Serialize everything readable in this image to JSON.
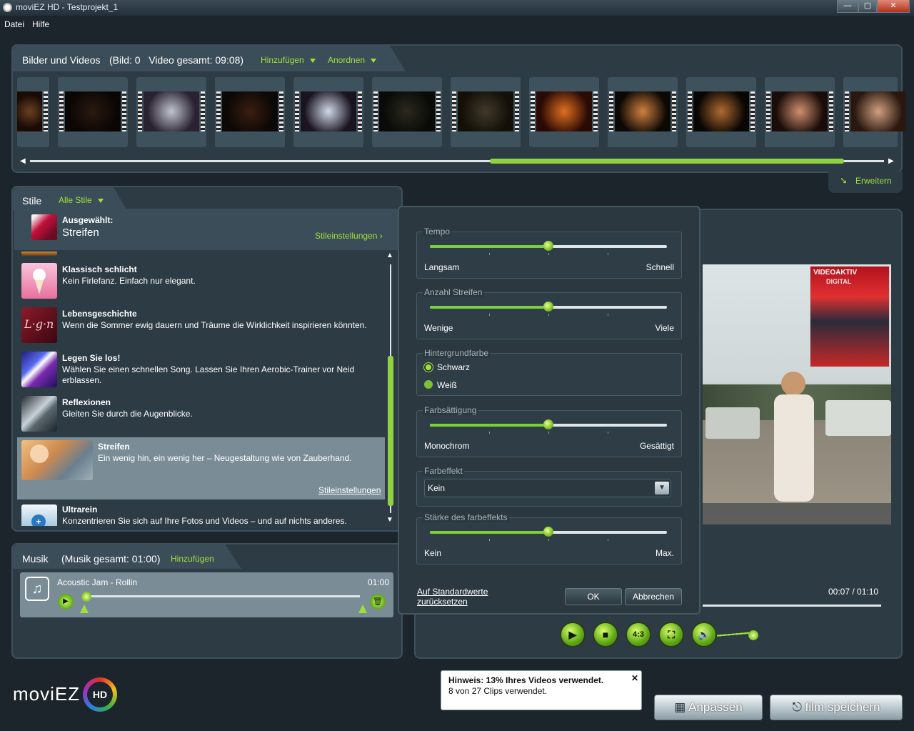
{
  "window": {
    "title": "moviEZ HD - Testprojekt_1",
    "min": "—",
    "max": "▢",
    "close": "✕"
  },
  "menu": [
    "Datei",
    "Hilfe"
  ],
  "media": {
    "title": "Bilder und Videos",
    "info": "(Bild: 0   Video gesamt: 09:08)",
    "add": "Hinzufügen",
    "arrange": "Anordnen",
    "expand": "Erweitern",
    "scroll_fraction": 0.44
  },
  "styles": {
    "title": "Stile",
    "filter": "Alle Stile",
    "selected_label": "Ausgewählt:",
    "selected_name": "Streifen",
    "settings_link": "Stileinstellungen",
    "items": [
      {
        "name": "Klassisch schlicht",
        "desc": "Kein Firlefanz. Einfach nur elegant."
      },
      {
        "name": "Lebensgeschichte",
        "desc": "Wenn die Sommer ewig dauern und Träume die Wirklichkeit inspirieren könnten."
      },
      {
        "name": "Legen Sie los!",
        "desc": "Wählen Sie einen schnellen Song. Lassen Sie Ihren Aerobic-Trainer vor Neid erblassen."
      },
      {
        "name": "Reflexionen",
        "desc": "Gleiten Sie durch die Augenblicke."
      },
      {
        "name": "Streifen",
        "desc": "Ein wenig hin, ein wenig her – Neugestaltung wie von Zauberhand.",
        "link": "Stileinstellungen"
      },
      {
        "name": "Ultrarein",
        "desc": "Konzentrieren Sie sich auf Ihre Fotos und Videos – und auf nichts anderes."
      }
    ]
  },
  "music": {
    "title": "Musik",
    "info": "(Musik gesamt: 01:00)",
    "add": "Hinzufügen",
    "track": "Acoustic Jam - Rollin",
    "duration": "01:00"
  },
  "dialog": {
    "tempo": {
      "label": "Tempo",
      "lo": "Langsam",
      "hi": "Schnell",
      "value": 0.5
    },
    "stripes": {
      "label": "Anzahl Streifen",
      "lo": "Wenige",
      "hi": "Viele",
      "value": 0.5
    },
    "bg": {
      "label": "Hintergrundfarbe",
      "opt1": "Schwarz",
      "opt2": "Weiß",
      "selected": "Schwarz"
    },
    "saturation": {
      "label": "Farbsättigung",
      "lo": "Monochrom",
      "hi": "Gesättigt",
      "value": 0.5
    },
    "effect": {
      "label": "Farbeffekt",
      "value": "Kein"
    },
    "strength": {
      "label": "Stärke des farbeffekts",
      "lo": "Kein",
      "hi": "Max.",
      "value": 0.5
    },
    "reset": "Auf Standardwerte zurücksetzen",
    "ok": "OK",
    "cancel": "Abbrechen"
  },
  "preview": {
    "time": "00:07 / 01:10",
    "mag_title": "VIDEOAKTIV",
    "mag_sub": "DIGITAL",
    "aspect": "4:3"
  },
  "hint": {
    "title": "Hinweis: 13% Ihres Videos verwendet.",
    "text": "8 von 27 Clips verwendet.",
    "close": "✕"
  },
  "buttons": {
    "customize": "Anpassen",
    "save": "film speichern"
  },
  "logo": {
    "text": "moviEZ",
    "badge": "HD"
  }
}
